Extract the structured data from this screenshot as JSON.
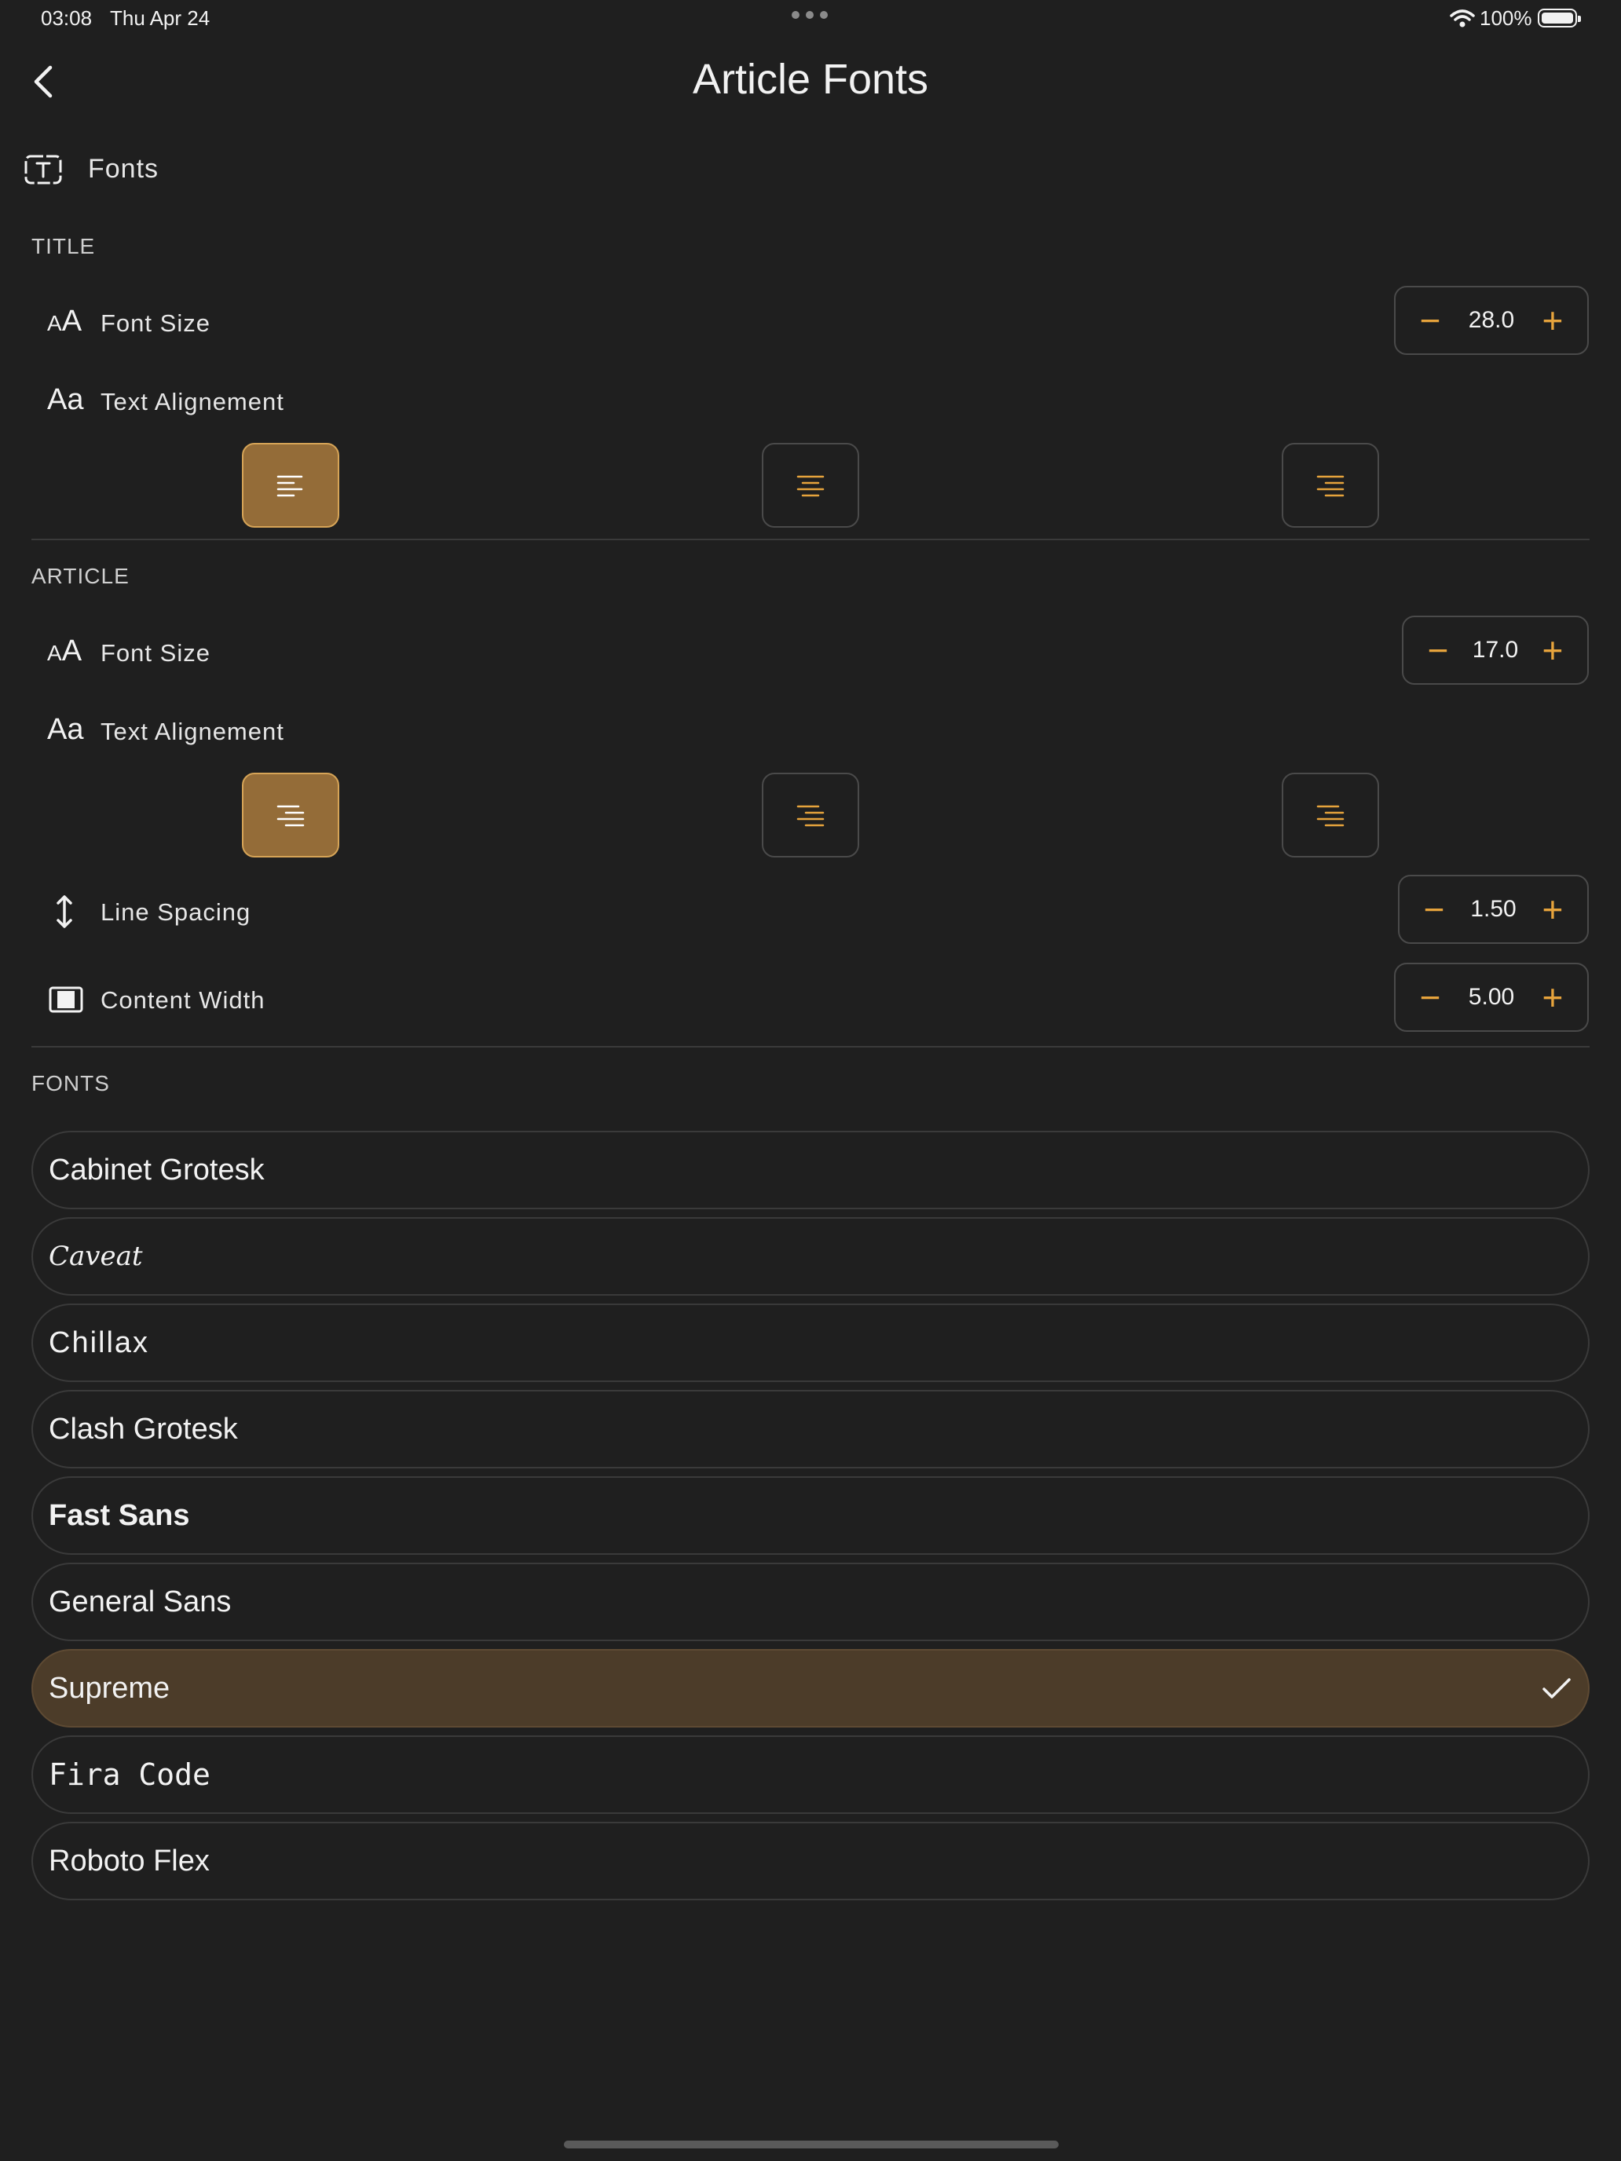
{
  "status_bar": {
    "time": "03:08",
    "date": "Thu Apr 24",
    "battery": "100%"
  },
  "nav": {
    "title": "Article Fonts"
  },
  "header": {
    "label": "Fonts"
  },
  "title_section": {
    "label": "TITLE",
    "font_size_label": "Font Size",
    "font_size_value": "28.0",
    "alignment_label": "Text Alignement",
    "alignment_selected": "left"
  },
  "article_section": {
    "label": "ARTICLE",
    "font_size_label": "Font Size",
    "font_size_value": "17.0",
    "alignment_label": "Text Alignement",
    "alignment_selected": "left",
    "line_spacing_label": "Line Spacing",
    "line_spacing_value": "1.50",
    "content_width_label": "Content Width",
    "content_width_value": "5.00"
  },
  "fonts_section": {
    "label": "FONTS",
    "items": [
      {
        "name": "Cabinet Grotesk"
      },
      {
        "name": "Caveat"
      },
      {
        "name": "Chillax"
      },
      {
        "name": "Clash Grotesk"
      },
      {
        "name": "Fast Sans"
      },
      {
        "name": "General Sans"
      },
      {
        "name": "Supreme",
        "selected": true
      },
      {
        "name": "Fira Code"
      },
      {
        "name": "Roboto Flex"
      }
    ]
  },
  "icons": {
    "aa_small": "AA",
    "aa_text": "Aa"
  },
  "colors": {
    "accent": "#e6a33c",
    "selected_align_bg": "#946c38",
    "selected_font_bg": "#4c3c29",
    "background": "#1f1f1f"
  }
}
